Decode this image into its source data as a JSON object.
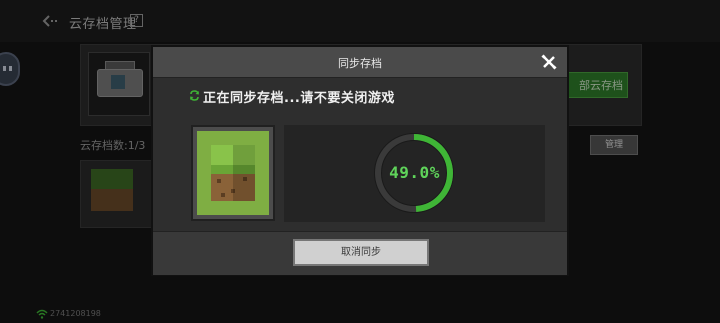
{
  "header": {
    "title": "云存档管理",
    "help_label": "?"
  },
  "background": {
    "restore_button_label": "部云存档",
    "count_label": "云存档数:1/3",
    "manage_button_label": "管理",
    "footer_id": "2741208198"
  },
  "dialog": {
    "title": "同步存档",
    "status_text": "正在同步存档...请不要关闭游戏",
    "progress": 0.49,
    "progress_label": "49.0%",
    "cancel_label": "取消同步"
  },
  "colors": {
    "accent_green": "#3fb536",
    "progress_text": "#5fd35a"
  }
}
